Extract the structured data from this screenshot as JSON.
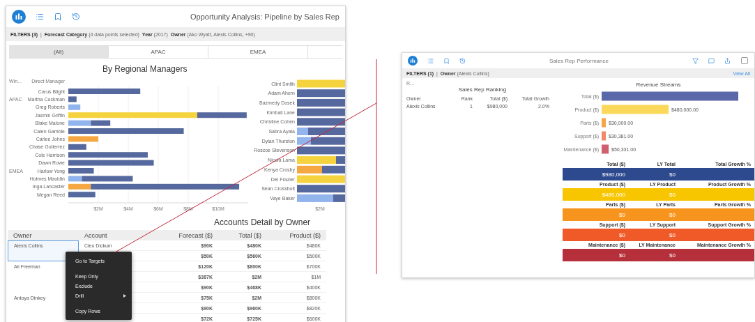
{
  "left_window": {
    "title": "Opportunity Analysis: Pipeline by Sales Rep",
    "filters": "**FILTERS (3)**  |  **Forecast Category** (4 data points selected)  **Year** (2017)  **Owner** (Ako Wyatt, Alexis Collins, +90)",
    "tabs": [
      {
        "label": "(All)",
        "selected": true
      },
      {
        "label": "APAC",
        "selected": false
      },
      {
        "label": "EMEA",
        "selected": false
      }
    ],
    "manager_chart": {
      "title": "By Regional Managers",
      "column_headers": [
        "Win...",
        "Direct Manager"
      ],
      "chart_data": {
        "type": "bar",
        "orientation": "horizontal",
        "stacked": true,
        "grid": true,
        "categories": [
          "Carus Blight",
          "Martha Cockman",
          "Greg Roberts",
          "Jasmin Griffin",
          "Blake Malone",
          "Calen Gamble",
          "Carlee Johns",
          "Chase Gutierrez",
          "Cole Harrison",
          "Dawn Rowe",
          "Harlow Yong",
          "Holmes Mauldin",
          "Inga Lancaster",
          "Megan Reed"
        ],
        "series": [
          {
            "color": "#f5d33f",
            "values": [
              null,
              null,
              null,
              8.6,
              null,
              null,
              null,
              null,
              null,
              null,
              null,
              null,
              null,
              null
            ]
          },
          {
            "color": "#92b4ec",
            "values": [
              null,
              null,
              0.8,
              null,
              1.5,
              null,
              null,
              null,
              null,
              null,
              null,
              0.9,
              null,
              null
            ]
          },
          {
            "color": "#f5a742",
            "values": [
              null,
              null,
              null,
              null,
              null,
              null,
              2.0,
              null,
              null,
              null,
              null,
              null,
              1.5,
              null
            ]
          },
          {
            "color": "#56699f",
            "values": [
              4.8,
              0.55,
              null,
              3.3,
              1.3,
              7.7,
              null,
              1.2,
              5.3,
              5.7,
              1.7,
              3.4,
              9.9,
              1.8
            ]
          }
        ],
        "xlim": [
          0,
          12
        ],
        "xticks": [
          {
            "value": 2,
            "label": "$2M"
          },
          {
            "value": 4,
            "label": "$4M"
          },
          {
            "value": 6,
            "label": "$6M"
          },
          {
            "value": 8,
            "label": "$8M"
          },
          {
            "value": 10,
            "label": "$10M"
          }
        ],
        "annotations": [
          "APAC",
          "EMEA"
        ]
      }
    },
    "side_chart": {
      "names": [
        "Clint Smith",
        "Adam Ahern",
        "Bazmedy Dosek",
        "Kimball Lane",
        "Christine Cohen",
        "Sabra Ayala",
        "Dylan Thurston",
        "Roscoe Stevenson",
        "Nicola Lama",
        "Kenya Crosby",
        "Del Frazier",
        "Sean Crossbolt",
        "Vaye Baker"
      ],
      "axis_label": "$2M"
    },
    "accounts_table": {
      "title": "Accounts Detail by Owner",
      "columns": [
        "Owner",
        "Account",
        "Forecast ($)",
        "Total ($)",
        "Product ($)"
      ],
      "owners": [
        {
          "name": "Alexis Collins",
          "selected": true,
          "rows": [
            {
              "account": "Cleo Dickum",
              "forecast": "$90K",
              "total": "$480K",
              "product": "$480K"
            },
            {
              "forecast": "$50K",
              "total": "$560K",
              "product": "$500K"
            }
          ]
        },
        {
          "name": "Ali Freeman",
          "selected": false,
          "rows": [
            {
              "forecast": "$120K",
              "total": "$800K",
              "product": "$700K"
            },
            {
              "forecast": "$387K",
              "total": "$2M",
              "product": "$1M"
            },
            {
              "forecast": "$90K",
              "total": "$468K",
              "product": "$400K"
            }
          ]
        },
        {
          "name": "Antoya Dinkey",
          "selected": false,
          "rows": [
            {
              "forecast": "$75K",
              "total": "$2M",
              "product": "$800K"
            },
            {
              "forecast": "$90K",
              "total": "$960K",
              "product": "$820K"
            },
            {
              "forecast": "$72K",
              "total": "$725K",
              "product": "$600K"
            }
          ]
        }
      ]
    },
    "context_menu": {
      "groups": [
        [
          {
            "label": "Go to Targets",
            "submenu": false
          }
        ],
        [
          {
            "label": "Keep Only",
            "submenu": false
          },
          {
            "label": "Exclude",
            "submenu": false
          },
          {
            "label": "Drill",
            "submenu": true
          }
        ],
        [
          {
            "label": "Copy Rows",
            "submenu": false
          }
        ]
      ]
    }
  },
  "right_window": {
    "title": "Sales Rep Performance",
    "filters": "**FILTERS (1)**  |  **Owner** (Alexis Collins)",
    "view_all": "View All",
    "ranking": {
      "corner_label": "R...",
      "title": "Sales Rep Ranking",
      "columns": [
        "Owner",
        "Rank",
        "Total ($)",
        "Total Growth"
      ],
      "rows": [
        [
          "Alexis Collins",
          "1",
          "$980,000",
          "2.0%"
        ]
      ]
    },
    "revenue": {
      "title": "Revenue Streams",
      "bars": [
        {
          "color": "#5a67a8"
        },
        {
          "color": "#fbd85a"
        },
        {
          "color": "#f7a449"
        },
        {
          "color": "#f08a6a"
        },
        {
          "color": "#d0606e"
        }
      ],
      "chart_data": {
        "type": "bar",
        "orientation": "horizontal",
        "categories": [
          "Total ($)",
          "Product ($)",
          "Parts ($)",
          "Support ($)",
          "Maintenance ($)"
        ],
        "values": [
          980000,
          480000,
          30000,
          30381,
          50331
        ],
        "value_labels": [
          null,
          "$480,000.00",
          "$30,000.00",
          "$30,381.00",
          "$50,331.00"
        ]
      }
    },
    "kpis": [
      {
        "color": "#2d4a8f",
        "labels": [
          "Total ($)",
          "LY Total",
          "Total Growth %"
        ],
        "values": [
          "$980,000",
          "$0"
        ]
      },
      {
        "color": "#f7c600",
        "labels": [
          "Product ($)",
          "LY Product",
          "Product Growth %"
        ],
        "values": [
          "$480,000",
          "$0"
        ]
      },
      {
        "color": "#f7941d",
        "labels": [
          "Parts ($)",
          "LY Parts",
          "Parts Growth %"
        ],
        "values": [
          "$0",
          "$0"
        ]
      },
      {
        "color": "#f05a28",
        "labels": [
          "Support ($)",
          "LY Support",
          "Support Growth %"
        ],
        "values": [
          "$0",
          "$0"
        ]
      },
      {
        "color": "#b5303a",
        "labels": [
          "Maintenance ($)",
          "LY Maintenance",
          "Maintenance Growth %"
        ],
        "values": [
          "$0",
          "$0"
        ]
      }
    ]
  }
}
